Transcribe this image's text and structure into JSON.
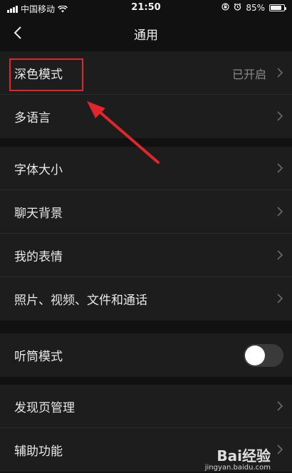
{
  "status_bar": {
    "carrier": "中国移动",
    "time": "21:50",
    "battery_percent": "85%",
    "battery_level": 0.85
  },
  "nav": {
    "title": "通用"
  },
  "settings": {
    "dark_mode": {
      "label": "深色模式",
      "value": "已开启"
    },
    "language": {
      "label": "多语言"
    },
    "font_size": {
      "label": "字体大小"
    },
    "chat_background": {
      "label": "聊天背景"
    },
    "my_stickers": {
      "label": "我的表情"
    },
    "media_files": {
      "label": "照片、视频、文件和通话"
    },
    "earpiece_mode": {
      "label": "听筒模式",
      "enabled": false
    },
    "discover_manage": {
      "label": "发现页管理"
    },
    "accessibility": {
      "label": "辅助功能"
    }
  },
  "watermark": {
    "logo_text": "Bai经验",
    "site": "jingyan.baidu.com"
  },
  "colors": {
    "background": "#111111",
    "cell": "#1d1d1d",
    "annotation": "#e0262b"
  }
}
